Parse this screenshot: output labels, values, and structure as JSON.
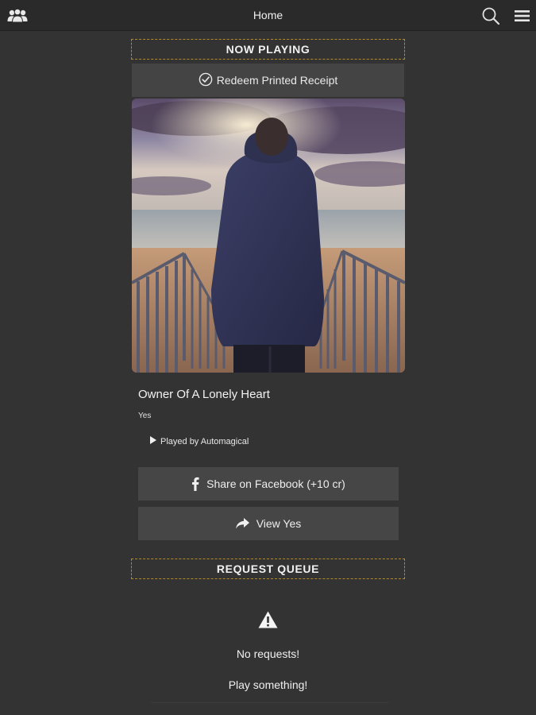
{
  "header": {
    "title": "Home",
    "left_icon": "group-icon",
    "search_icon": "search-icon",
    "menu_icon": "menu-icon"
  },
  "now_playing": {
    "section_label": "NOW PLAYING",
    "redeem_label": "Redeem Printed Receipt",
    "album_art": "album-art",
    "song_title": "Owner Of A Lonely Heart",
    "artist": "Yes",
    "played_by": "Played by Automagical",
    "share_label": "Share on Facebook (+10 cr)",
    "view_label": "View Yes"
  },
  "request_queue": {
    "section_label": "REQUEST QUEUE",
    "empty_icon": "warning-icon",
    "empty_title": "No requests!",
    "empty_subtitle": "Play something!"
  },
  "colors": {
    "background": "#333333",
    "topbar": "#2a2a2a",
    "button": "#444444",
    "header_border": "#b48a24"
  }
}
